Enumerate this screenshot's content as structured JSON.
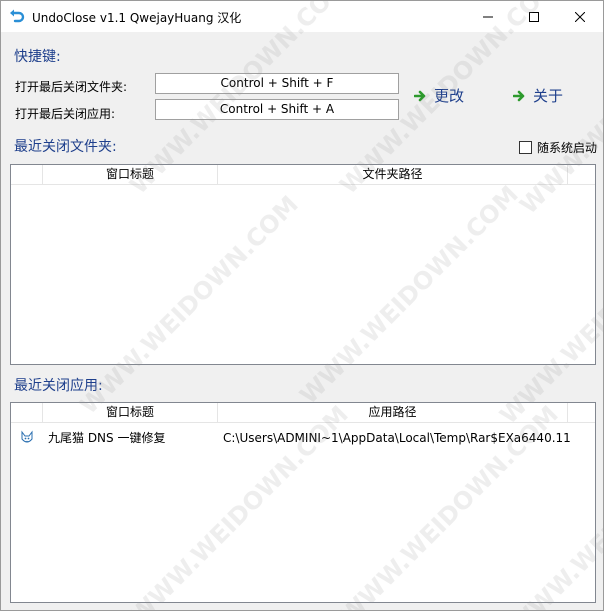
{
  "window": {
    "title": "UndoClose v1.1  QwejayHuang 汉化",
    "accent_color": "#1e3f8c"
  },
  "hotkeys": {
    "section_label": "快捷键:",
    "folder_label": "打开最后关闭文件夹:",
    "folder_value": "Control + Shift + F",
    "app_label": "打开最后关闭应用:",
    "app_value": "Control + Shift + A",
    "change_label": "更改",
    "about_label": "关于"
  },
  "folders": {
    "section_label": "最近关闭文件夹:",
    "autostart_label": "随系统启动",
    "columns": [
      "窗口标题",
      "文件夹路径"
    ],
    "rows": []
  },
  "apps": {
    "section_label": "最近关闭应用:",
    "columns": [
      "窗口标题",
      "应用路径"
    ],
    "rows": [
      {
        "icon": "fox-app-icon",
        "title": "九尾猫 DNS 一键修复",
        "path": "C:\\Users\\ADMINI~1\\AppData\\Local\\Temp\\Rar$EXa6440.11"
      }
    ]
  },
  "watermark": "WWW.WEIDOWN.COM"
}
